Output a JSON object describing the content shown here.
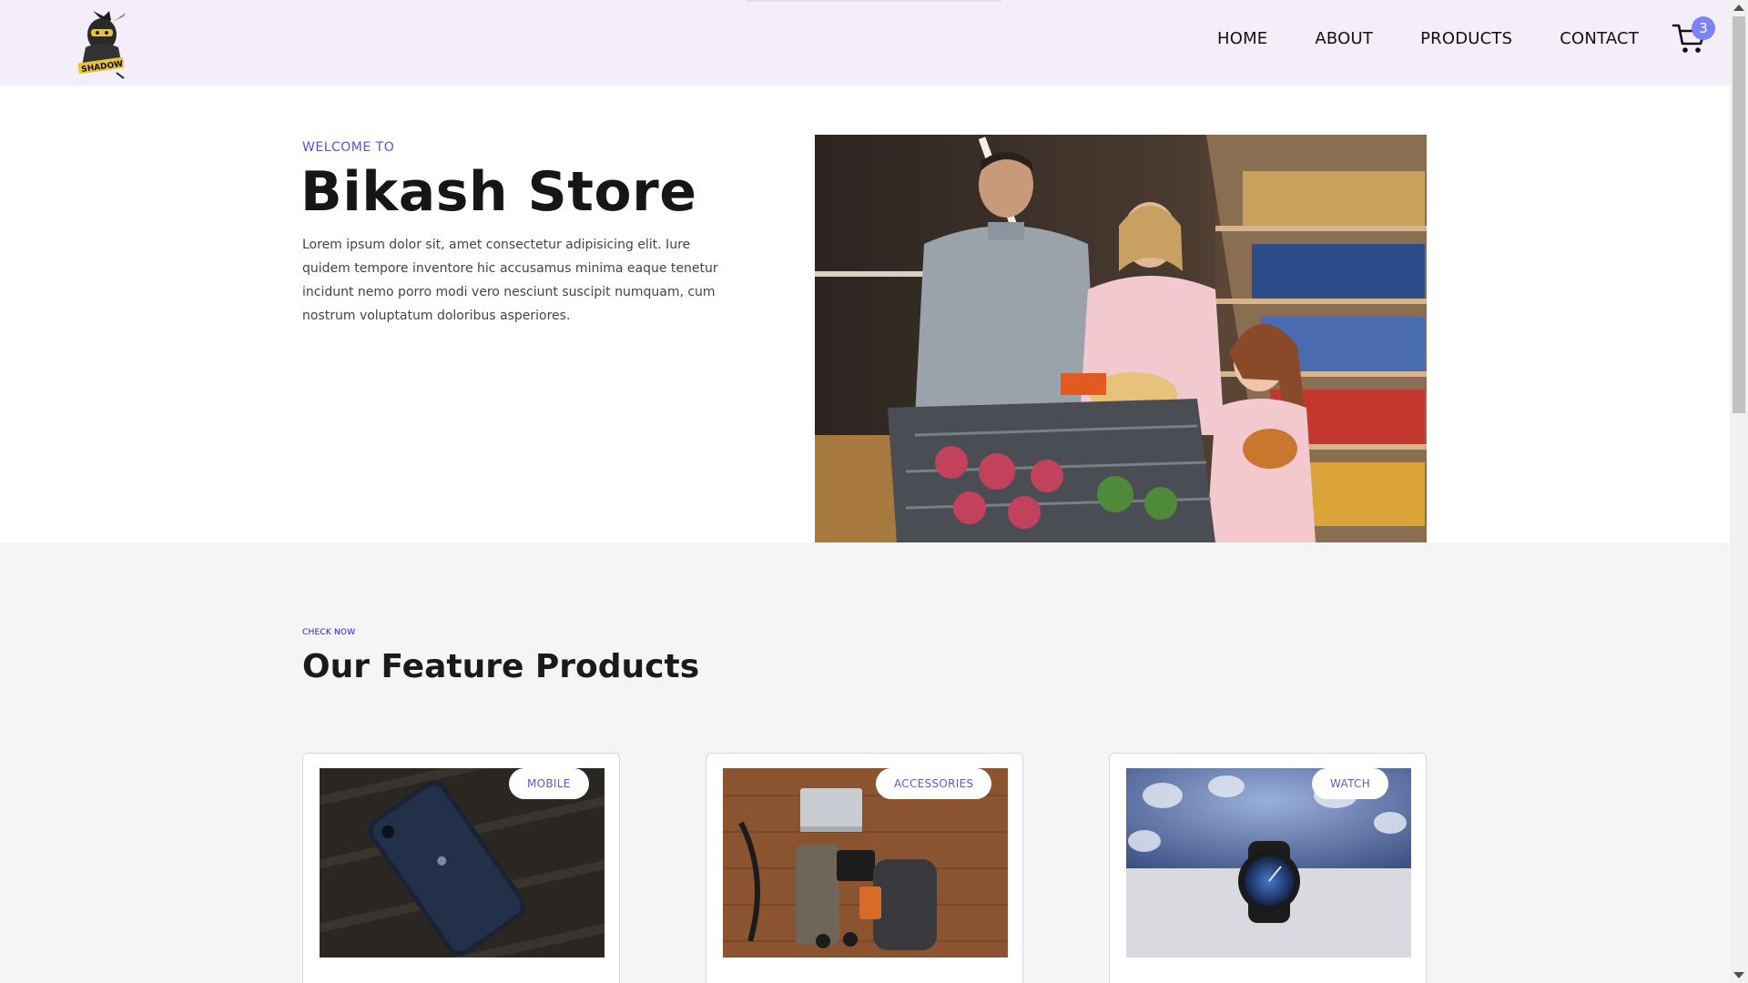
{
  "brand": {
    "logo_icon": "ninja-shadow-logo",
    "logo_text": "SHADOW"
  },
  "nav": {
    "items": [
      {
        "label": "HOME"
      },
      {
        "label": "ABOUT"
      },
      {
        "label": "PRODUCTS"
      },
      {
        "label": "CONTACT"
      }
    ],
    "cart_icon": "cart-icon",
    "cart_count": "3"
  },
  "hero": {
    "eyebrow": "WELCOME TO",
    "title": "Bikash Store",
    "description": "Lorem ipsum dolor sit, amet consectetur adipisicing elit. Iure quidem tempore inventore hic accusamus minima eaque tenetur incidunt nemo porro modi vero nesciunt suscipit numquam, cum nostrum voluptatum doloribus asperiores."
  },
  "features": {
    "eyebrow": "CHECK NOW",
    "title": "Our Feature Products",
    "products": [
      {
        "category": "MOBILE"
      },
      {
        "category": "ACCESSORIES"
      },
      {
        "category": "WATCH"
      }
    ]
  },
  "colors": {
    "header_bg": "#f4eefa",
    "accent": "#5a4fe0",
    "badge": "#7d83f0",
    "section_bg": "#f5f5f5"
  }
}
